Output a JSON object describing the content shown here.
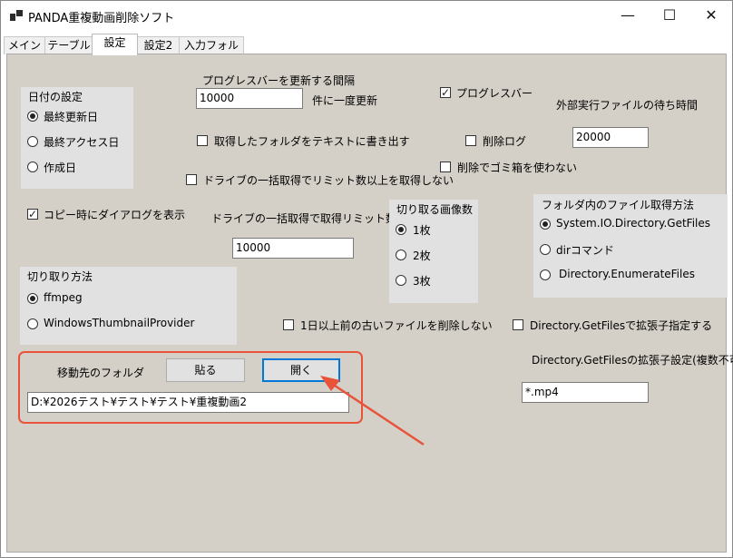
{
  "window": {
    "title": "PANDA重複動画削除ソフト",
    "minimize_glyph": "—",
    "maximize_glyph": "☐",
    "close_glyph": "✕"
  },
  "tabs": [
    "メイン",
    "テーブル",
    "設定",
    "設定2",
    "入力フォルダ"
  ],
  "active_tab": "設定",
  "date_group": {
    "title": "日付の設定",
    "options": [
      "最終更新日",
      "最終アクセス日",
      "作成日"
    ],
    "selected": "最終更新日"
  },
  "progress_interval": {
    "label": "プログレスバーを更新する間隔",
    "value": "10000",
    "suffix": "件に一度更新"
  },
  "checkboxes": {
    "progress_bar": {
      "label": "プログレスバー",
      "checked": true
    },
    "export_folders": {
      "label": "取得したフォルダをテキストに書き出す",
      "checked": false
    },
    "delete_log": {
      "label": "削除ログ",
      "checked": false
    },
    "drive_over_limit": {
      "label": "ドライブの一括取得でリミット数以上を取得しない",
      "checked": false
    },
    "no_recycle_bin": {
      "label": "削除でゴミ箱を使わない",
      "checked": false
    },
    "copy_dialog": {
      "label": "コピー時にダイアログを表示",
      "checked": true
    },
    "no_delete_old": {
      "label": "1日以上前の古いファイルを削除しない",
      "checked": false
    },
    "getfiles_ext": {
      "label": "Directory.GetFilesで拡張子指定する",
      "checked": false
    }
  },
  "external_wait": {
    "label": "外部実行ファイルの待ち時間",
    "value": "20000"
  },
  "drive_limit": {
    "label": "ドライブの一括取得で取得リミット数",
    "value": "10000"
  },
  "crop_count_group": {
    "title": "切り取る画像数",
    "options": [
      "1枚",
      "2枚",
      "3枚"
    ],
    "selected": "1枚"
  },
  "file_method_group": {
    "title": "フォルダ内のファイル取得方法",
    "options": [
      "System.IO.Directory.GetFiles",
      "dirコマンド",
      "Directory.EnumerateFiles"
    ],
    "selected": "System.IO.Directory.GetFiles"
  },
  "crop_method_group": {
    "title": "切り取り方法",
    "options": [
      "ffmpeg",
      "WindowsThumbnailProvider"
    ],
    "selected": "ffmpeg"
  },
  "move_folder": {
    "label": "移動先のフォルダ",
    "paste_button": "貼る",
    "open_button": "開く",
    "path": "D:¥2026テスト¥テスト¥テスト¥重複動画2"
  },
  "ext_setting": {
    "label": "Directory.GetFilesの拡張子設定(複数不可)",
    "value": "*.mp4"
  },
  "colors": {
    "panel": "#d4d0c8",
    "group": "#e1e1e1",
    "highlight": "#e8533a",
    "focus": "#0078d7"
  }
}
